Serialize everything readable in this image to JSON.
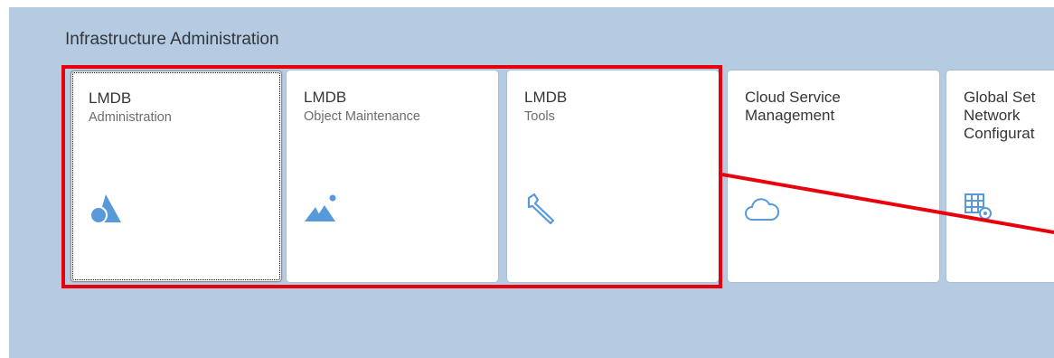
{
  "group": {
    "title": "Infrastructure Administration"
  },
  "tiles": [
    {
      "title": "LMDB",
      "subtitle": "Administration",
      "icon": "mountain-sun-icon"
    },
    {
      "title": "LMDB",
      "subtitle": "Object Maintenance",
      "icon": "landscape-icon"
    },
    {
      "title": "LMDB",
      "subtitle": "Tools",
      "icon": "wrench-icon"
    },
    {
      "title": "Cloud Service\nManagement",
      "subtitle": "",
      "icon": "cloud-icon"
    },
    {
      "title": "Global Set\nNetwork\nConfigurat",
      "subtitle": "",
      "icon": "table-gear-icon"
    }
  ],
  "colors": {
    "background": "#b5cbe2",
    "tile": "#ffffff",
    "icon": "#5899da",
    "annotation": "#e8000d"
  }
}
